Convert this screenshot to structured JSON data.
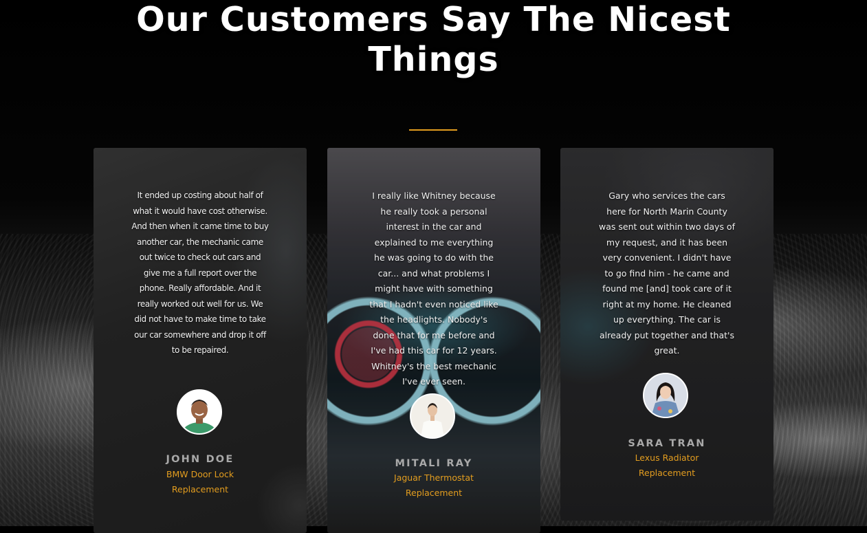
{
  "section": {
    "title_line1": "Our Customers Say The Nicest",
    "title_line2": "Things"
  },
  "colors": {
    "accent": "#e39d1f",
    "name_text": "#a9a9a9",
    "quote_text": "#f1f1f1"
  },
  "testimonials": [
    {
      "quote": "It ended up costing about half of what it would have cost otherwise. And then when it came time to buy another car, the mechanic came out twice to check out cars and give me a full report over the phone. Really affordable. And it really worked out well for us. We did not have to make time to take our car somewhere and drop it off to be repaired.",
      "name": "JOHN DOE",
      "service": "BMW Door Lock Replacement",
      "avatar_icon": "person-avatar-icon"
    },
    {
      "quote": "I really like Whitney because he really took a personal interest in the car and explained to me everything he was going to do with the car... and what problems I might have with something that I hadn't even noticed like the headlights. Nobody's done that for me before and I've had this car for 12 years. Whitney's the best mechanic I've ever seen.",
      "name": "MITALI RAY",
      "service": "Jaguar Thermostat Replacement",
      "avatar_icon": "person-avatar-icon"
    },
    {
      "quote": "Gary who services the cars here for North Marin County was sent out within two days of my request, and it has been very convenient. I didn't have to go find him - he came and found me [and] took care of it right at my home. He cleaned up everything. The car is already put together and that's great.",
      "name": "SARA TRAN",
      "service": "Lexus Radiator Replacement",
      "avatar_icon": "person-avatar-icon"
    }
  ]
}
